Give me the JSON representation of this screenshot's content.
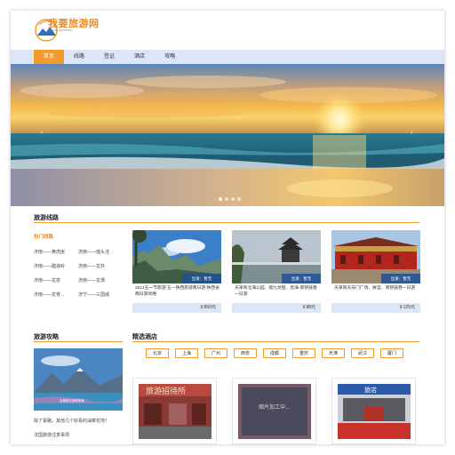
{
  "logo": {
    "text": "我要旅游网",
    "subtitle": "TRAVEL NETWORK"
  },
  "nav": {
    "items": [
      "首页",
      "线路",
      "签证",
      "酒店",
      "攻略"
    ]
  },
  "banner": {
    "prev": "‹",
    "next": "›"
  },
  "routes_section": {
    "title": "旅游线路",
    "hot_title": "热门线路",
    "routes": [
      "济南——黄虎崖",
      "济南——瑶头洼",
      "济南——踏浪岭",
      "济南——龙井",
      "济南——龙泉",
      "济南——龙潭",
      "济南——龙脊...",
      "济宁——三国城"
    ],
    "cards": [
      {
        "tag": "出发：暂无",
        "desc": "2014五一节旅游 五一陕西旅游两日游 陕西省两日游攻略",
        "price": "￥850元"
      },
      {
        "tag": "出发：暂无",
        "desc": "天津到北海公园、观九龙壁、后海-南锣鼓巷一日游",
        "price": "￥88元"
      },
      {
        "tag": "出发：暂无",
        "desc": "天津到天安门广场、故宫、南锣鼓巷一日游",
        "price": "￥125元"
      }
    ]
  },
  "guides_section": {
    "title": "旅游攻略",
    "image_caption": "坐拥桃花源般美景",
    "items": [
      "除了豪路，其他几个好看的油菜花地！",
      "法国旅游注意事项"
    ]
  },
  "hotels_section": {
    "title": "精选酒店",
    "cities": [
      "北京",
      "上海",
      "广州",
      "西安",
      "成都",
      "重庆",
      "天津",
      "武汉",
      "厦门"
    ],
    "hotels": [
      {
        "sign": "旅游招待所"
      },
      {
        "placeholder": "图片加工中..."
      },
      {
        "sign": "旅店"
      }
    ]
  },
  "colors": {
    "accent": "#f39b2f",
    "nav_bg": "#dde6f7",
    "tag_bg": "#1e5096"
  }
}
